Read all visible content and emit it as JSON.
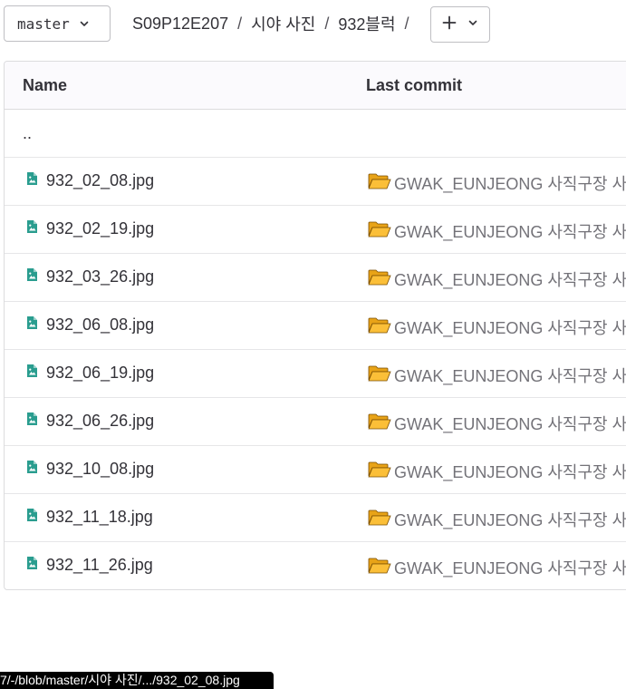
{
  "branch": {
    "label": "master"
  },
  "breadcrumb": {
    "items": [
      "S09P12E207",
      "시야 사진",
      "932블럭"
    ],
    "separator": "/"
  },
  "add_button": {
    "icon": "plus-icon",
    "dropdown_icon": "chevron-down-icon"
  },
  "table": {
    "headers": {
      "name": "Name",
      "last_commit": "Last commit"
    },
    "parent_dir": "..",
    "rows": [
      {
        "name": "932_02_08.jpg",
        "commit": "GWAK_EUNJEONG 사직구장 사"
      },
      {
        "name": "932_02_19.jpg",
        "commit": "GWAK_EUNJEONG 사직구장 사"
      },
      {
        "name": "932_03_26.jpg",
        "commit": "GWAK_EUNJEONG 사직구장 사"
      },
      {
        "name": "932_06_08.jpg",
        "commit": "GWAK_EUNJEONG 사직구장 사"
      },
      {
        "name": "932_06_19.jpg",
        "commit": "GWAK_EUNJEONG 사직구장 사"
      },
      {
        "name": "932_06_26.jpg",
        "commit": "GWAK_EUNJEONG 사직구장 사"
      },
      {
        "name": "932_10_08.jpg",
        "commit": "GWAK_EUNJEONG 사직구장 사"
      },
      {
        "name": "932_11_18.jpg",
        "commit": "GWAK_EUNJEONG 사직구장 사"
      },
      {
        "name": "932_11_26.jpg",
        "commit": "GWAK_EUNJEONG 사직구장 사"
      }
    ]
  },
  "status_tooltip": {
    "text": "7/-/blob/master/시야 사진/.../932_02_08.jpg"
  },
  "colors": {
    "file_icon": "#2a9d8f",
    "folder_icon": "#f0a30a",
    "commit_text": "#737278"
  }
}
